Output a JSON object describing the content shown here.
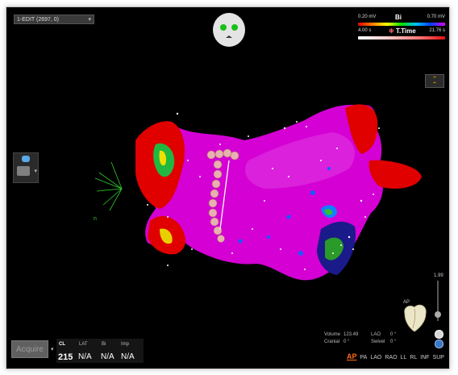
{
  "map_selector": {
    "label": "1-EDIT (2697, 0)"
  },
  "legend": {
    "bi": {
      "name": "Bi",
      "min": "0.20 mV",
      "max": "0.70 mV"
    },
    "ttime": {
      "name": "T.Time",
      "min": "4.00 s",
      "max": "21.76 s"
    }
  },
  "axis_label": "n",
  "acquire_button": "Acquire",
  "stats": {
    "headers": {
      "cl": "CL",
      "lat": "LAT",
      "bi": "Bi",
      "imp": "Imp"
    },
    "values": {
      "cl": "215",
      "lat": "N/A",
      "bi": "N/A",
      "imp": "N/A"
    }
  },
  "view_info": {
    "volume_label": "Volume",
    "volume_value": "123.49",
    "lao_label": "LAO",
    "lao_value": "0 °",
    "cranial_label": "Cranial",
    "cranial_value": "0 °",
    "swivel_label": "Swivel",
    "swivel_value": "0 °"
  },
  "view_buttons": [
    "AP",
    "PA",
    "LAO",
    "RAO",
    "LL",
    "RL",
    "INF",
    "SUP"
  ],
  "active_view": "AP",
  "zoom_value": "1.99",
  "orientation_label": "AP",
  "colors": {
    "magenta": "#d400d4",
    "red": "#e00000",
    "accent_orange": "#ff6a1a",
    "background": "#000000"
  },
  "icons": {
    "head": "patient-head-icon",
    "heart": "heart-orientation-icon",
    "help": "help-icon",
    "rotate": "rotate-icon"
  }
}
